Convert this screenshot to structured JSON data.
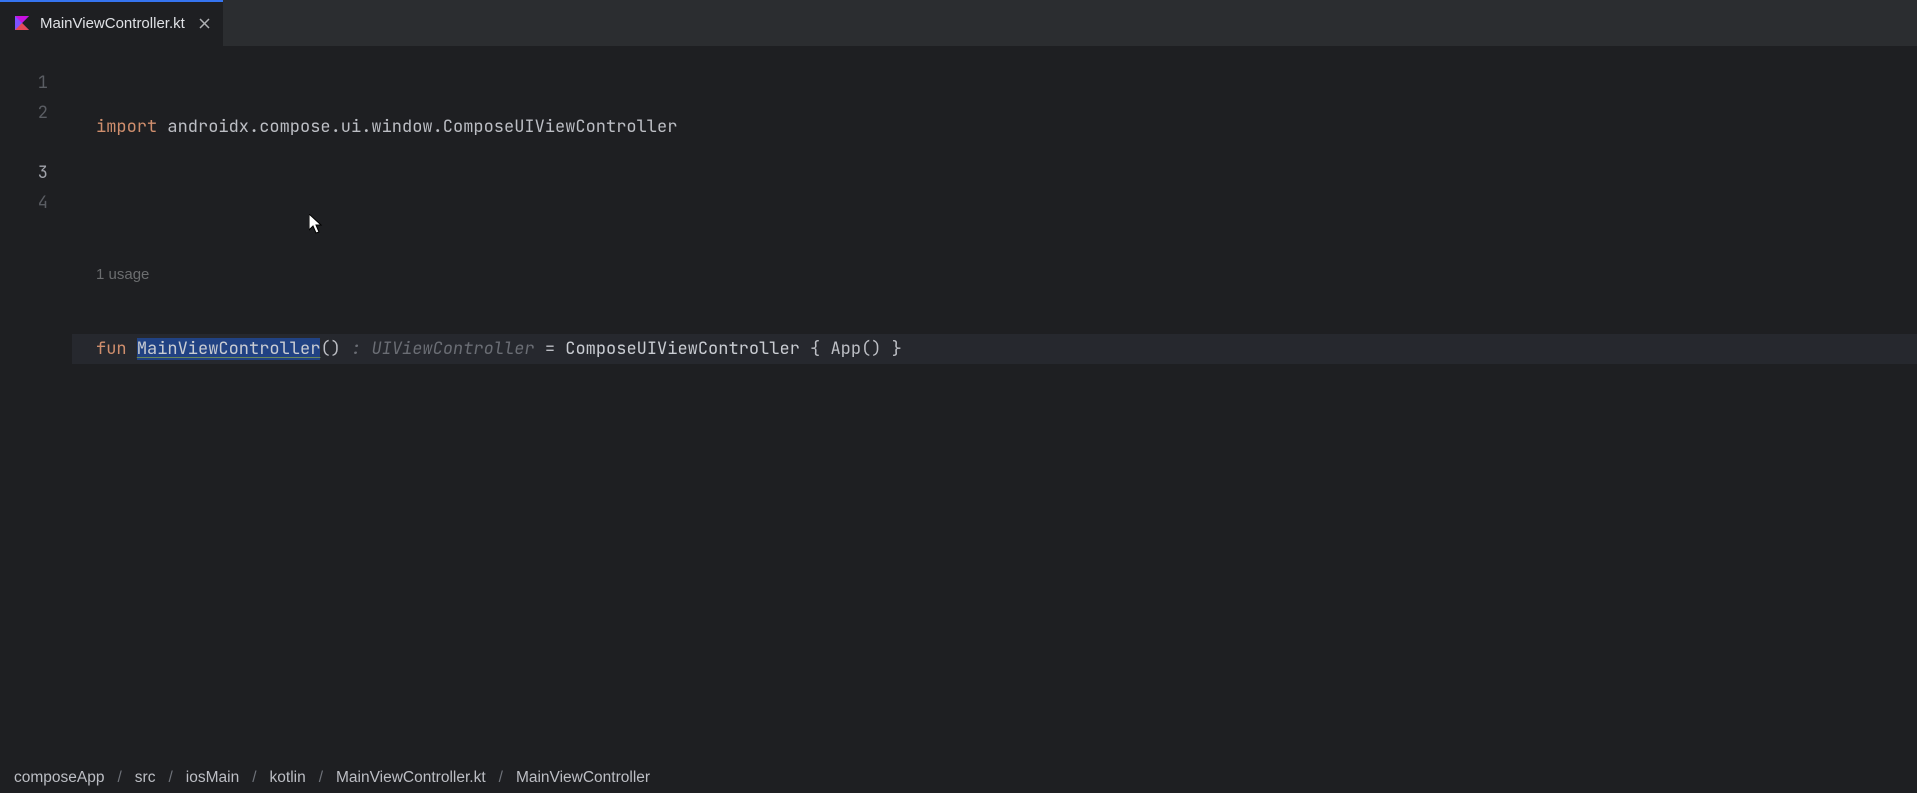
{
  "tab": {
    "file_name": "MainViewController.kt",
    "icon": "kotlin-file-icon"
  },
  "editor": {
    "usage_hint": "1 usage",
    "line_numbers": [
      "1",
      "2",
      "3",
      "4"
    ],
    "code": {
      "line1": {
        "keyword": "import",
        "package": "androidx.compose.ui.window.ComposeUIViewController"
      },
      "line3": {
        "keyword": "fun",
        "function_name": "MainViewController",
        "parens": "()",
        "type_hint_colon": ": ",
        "type_hint": "UIViewController",
        "equals": " = ",
        "call": "ComposeUIViewController",
        "body": " { App() }"
      }
    }
  },
  "breadcrumb": {
    "items": [
      "composeApp",
      "src",
      "iosMain",
      "kotlin",
      "MainViewController.kt",
      "MainViewController"
    ],
    "separator": "/"
  }
}
